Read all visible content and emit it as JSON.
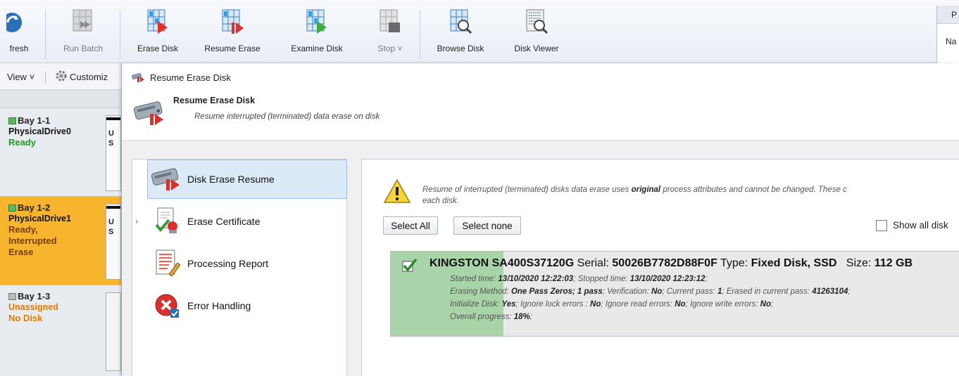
{
  "toolbar": {
    "buttons": [
      {
        "label": "fresh",
        "icon": "refresh-icon",
        "enabled": true
      },
      {
        "label": "Run Batch",
        "icon": "run-batch-icon",
        "enabled": false
      },
      {
        "label": "Erase Disk",
        "icon": "erase-disk-icon",
        "enabled": true
      },
      {
        "label": "Resume Erase",
        "icon": "resume-erase-icon",
        "enabled": true
      },
      {
        "label": "Examine Disk",
        "icon": "examine-disk-icon",
        "enabled": true
      },
      {
        "label": "Stop",
        "icon": "stop-icon",
        "enabled": false
      },
      {
        "label": "Browse Disk",
        "icon": "browse-disk-icon",
        "enabled": true
      },
      {
        "label": "Disk Viewer",
        "icon": "disk-viewer-icon",
        "enabled": true
      }
    ],
    "right_clip_top": "P",
    "right_clip_bottom": "Na"
  },
  "leftpane": {
    "view_label": "View",
    "customize_label": "Customiz",
    "bays": [
      {
        "title": "Bay 1-1",
        "drive": "PhysicalDrive0",
        "status": "Ready",
        "status_color": "#1f9a1f",
        "box_text": "U\nS",
        "selected": false,
        "indicator": "green"
      },
      {
        "title": "Bay 1-2",
        "drive": "PhysicalDrive1",
        "status": "Ready,\nInterrupted\nErase",
        "status_color": "#7a3b00",
        "box_text": "U\nS",
        "selected": true,
        "indicator": "green"
      },
      {
        "title": "Bay 1-3",
        "drive": "Unassigned",
        "status": "No Disk",
        "status_color": "#e07b00",
        "box_text": "",
        "selected": false,
        "indicator": "gray"
      }
    ]
  },
  "dialog": {
    "window_title": "Resume Erase Disk",
    "header_title": "Resume Erase Disk",
    "header_subtitle": "Resume interrupted (terminated) data erase on disk",
    "nav": [
      {
        "label": "Disk Erase Resume",
        "icon": "disk-erase-resume-icon",
        "selected": true
      },
      {
        "label": "Erase Certificate",
        "icon": "certificate-icon",
        "selected": false,
        "expandable": true
      },
      {
        "label": "Processing Report",
        "icon": "report-icon",
        "selected": false
      },
      {
        "label": "Error Handling",
        "icon": "error-icon",
        "selected": false
      }
    ],
    "content": {
      "warning_line1_pre": "Resume of interrupted (terminated) disks data erase uses ",
      "warning_line1_bold": "original",
      "warning_line1_post": " process attributes and cannot be changed. These c",
      "warning_line2": "each disk.",
      "select_all": "Select All",
      "select_none": "Select none",
      "show_all_disks": "Show all disk",
      "disk": {
        "checked": true,
        "model": "KINGSTON SA400S37120G",
        "serial_label": "Serial:",
        "serial": "50026B7782D88F0F",
        "type_label": "Type:",
        "type": "Fixed Disk, SSD",
        "size_label": "Size:",
        "size": "112 GB",
        "started_label": "Started time:",
        "started": "13/10/2020 12:22:03",
        "stopped_label": "Stopped time:",
        "stopped": "13/10/2020 12:23:12",
        "method_label": "Erasing Method:",
        "method": "One Pass Zeros; 1 pass",
        "verification_label": "Verification:",
        "verification": "No",
        "current_pass_label": "Current pass:",
        "current_pass": "1",
        "erased_label": "Erased in current pass:",
        "erased": "41263104",
        "init_label": "Initialize Disk:",
        "init": "Yes",
        "lock_label": "Ignore lock errors :",
        "lock": "No",
        "read_label": "Ignore read errors:",
        "read": "No",
        "write_label": "Ignore write errors:",
        "write": "No",
        "progress_label": "Overall progress:",
        "progress_text": "18%",
        "progress": 0.18
      }
    }
  },
  "colors": {
    "selected_bay": "#f6b52c",
    "progress_fill": "#a9d4a9",
    "nav_selected": "#dce9f7"
  }
}
